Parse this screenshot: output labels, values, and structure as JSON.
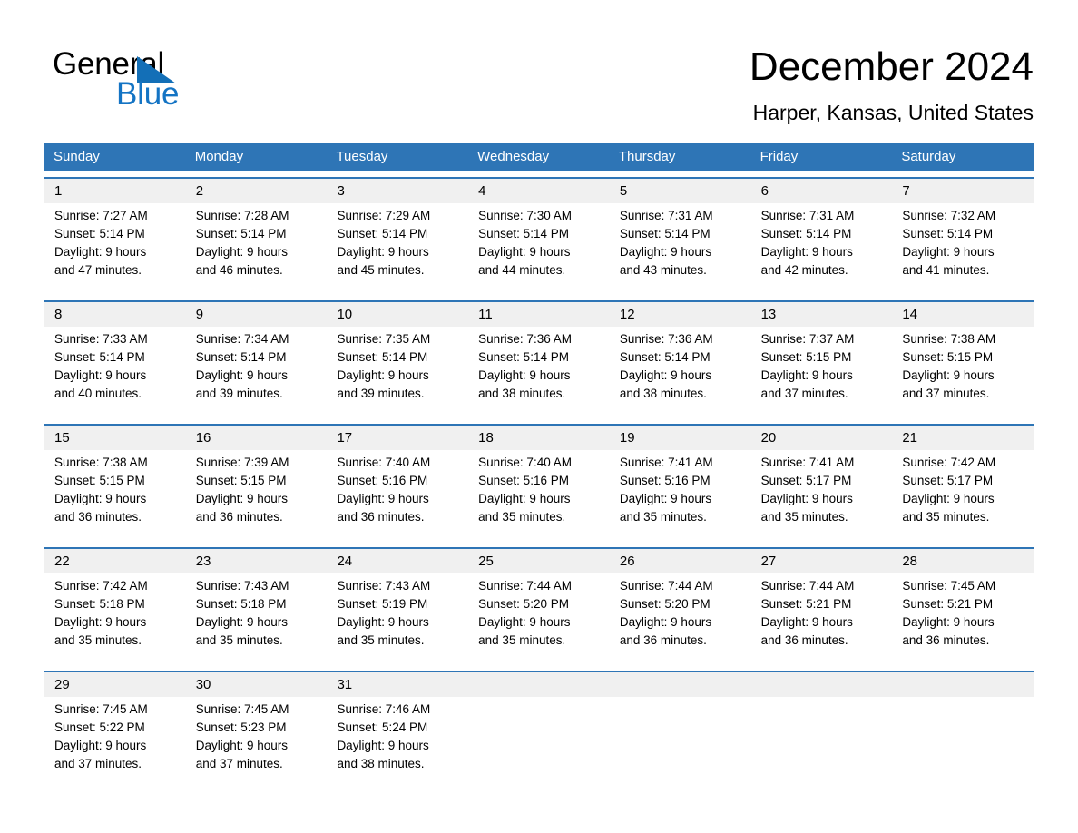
{
  "brand": {
    "name_part1": "General",
    "name_part2": "Blue",
    "triangle_color": "#136fb7",
    "blue_text_color": "#1474c4"
  },
  "header": {
    "month_title": "December 2024",
    "location": "Harper, Kansas, United States"
  },
  "theme": {
    "header_blue": "#2e75b6",
    "daynum_band": "#f0f0f0",
    "text": "#000000",
    "header_text": "#ffffff"
  },
  "weekdays": [
    "Sunday",
    "Monday",
    "Tuesday",
    "Wednesday",
    "Thursday",
    "Friday",
    "Saturday"
  ],
  "weeks": [
    {
      "days": [
        {
          "num": "1",
          "sunrise": "Sunrise: 7:27 AM",
          "sunset": "Sunset: 5:14 PM",
          "daylight1": "Daylight: 9 hours",
          "daylight2": "and 47 minutes."
        },
        {
          "num": "2",
          "sunrise": "Sunrise: 7:28 AM",
          "sunset": "Sunset: 5:14 PM",
          "daylight1": "Daylight: 9 hours",
          "daylight2": "and 46 minutes."
        },
        {
          "num": "3",
          "sunrise": "Sunrise: 7:29 AM",
          "sunset": "Sunset: 5:14 PM",
          "daylight1": "Daylight: 9 hours",
          "daylight2": "and 45 minutes."
        },
        {
          "num": "4",
          "sunrise": "Sunrise: 7:30 AM",
          "sunset": "Sunset: 5:14 PM",
          "daylight1": "Daylight: 9 hours",
          "daylight2": "and 44 minutes."
        },
        {
          "num": "5",
          "sunrise": "Sunrise: 7:31 AM",
          "sunset": "Sunset: 5:14 PM",
          "daylight1": "Daylight: 9 hours",
          "daylight2": "and 43 minutes."
        },
        {
          "num": "6",
          "sunrise": "Sunrise: 7:31 AM",
          "sunset": "Sunset: 5:14 PM",
          "daylight1": "Daylight: 9 hours",
          "daylight2": "and 42 minutes."
        },
        {
          "num": "7",
          "sunrise": "Sunrise: 7:32 AM",
          "sunset": "Sunset: 5:14 PM",
          "daylight1": "Daylight: 9 hours",
          "daylight2": "and 41 minutes."
        }
      ]
    },
    {
      "days": [
        {
          "num": "8",
          "sunrise": "Sunrise: 7:33 AM",
          "sunset": "Sunset: 5:14 PM",
          "daylight1": "Daylight: 9 hours",
          "daylight2": "and 40 minutes."
        },
        {
          "num": "9",
          "sunrise": "Sunrise: 7:34 AM",
          "sunset": "Sunset: 5:14 PM",
          "daylight1": "Daylight: 9 hours",
          "daylight2": "and 39 minutes."
        },
        {
          "num": "10",
          "sunrise": "Sunrise: 7:35 AM",
          "sunset": "Sunset: 5:14 PM",
          "daylight1": "Daylight: 9 hours",
          "daylight2": "and 39 minutes."
        },
        {
          "num": "11",
          "sunrise": "Sunrise: 7:36 AM",
          "sunset": "Sunset: 5:14 PM",
          "daylight1": "Daylight: 9 hours",
          "daylight2": "and 38 minutes."
        },
        {
          "num": "12",
          "sunrise": "Sunrise: 7:36 AM",
          "sunset": "Sunset: 5:14 PM",
          "daylight1": "Daylight: 9 hours",
          "daylight2": "and 38 minutes."
        },
        {
          "num": "13",
          "sunrise": "Sunrise: 7:37 AM",
          "sunset": "Sunset: 5:15 PM",
          "daylight1": "Daylight: 9 hours",
          "daylight2": "and 37 minutes."
        },
        {
          "num": "14",
          "sunrise": "Sunrise: 7:38 AM",
          "sunset": "Sunset: 5:15 PM",
          "daylight1": "Daylight: 9 hours",
          "daylight2": "and 37 minutes."
        }
      ]
    },
    {
      "days": [
        {
          "num": "15",
          "sunrise": "Sunrise: 7:38 AM",
          "sunset": "Sunset: 5:15 PM",
          "daylight1": "Daylight: 9 hours",
          "daylight2": "and 36 minutes."
        },
        {
          "num": "16",
          "sunrise": "Sunrise: 7:39 AM",
          "sunset": "Sunset: 5:15 PM",
          "daylight1": "Daylight: 9 hours",
          "daylight2": "and 36 minutes."
        },
        {
          "num": "17",
          "sunrise": "Sunrise: 7:40 AM",
          "sunset": "Sunset: 5:16 PM",
          "daylight1": "Daylight: 9 hours",
          "daylight2": "and 36 minutes."
        },
        {
          "num": "18",
          "sunrise": "Sunrise: 7:40 AM",
          "sunset": "Sunset: 5:16 PM",
          "daylight1": "Daylight: 9 hours",
          "daylight2": "and 35 minutes."
        },
        {
          "num": "19",
          "sunrise": "Sunrise: 7:41 AM",
          "sunset": "Sunset: 5:16 PM",
          "daylight1": "Daylight: 9 hours",
          "daylight2": "and 35 minutes."
        },
        {
          "num": "20",
          "sunrise": "Sunrise: 7:41 AM",
          "sunset": "Sunset: 5:17 PM",
          "daylight1": "Daylight: 9 hours",
          "daylight2": "and 35 minutes."
        },
        {
          "num": "21",
          "sunrise": "Sunrise: 7:42 AM",
          "sunset": "Sunset: 5:17 PM",
          "daylight1": "Daylight: 9 hours",
          "daylight2": "and 35 minutes."
        }
      ]
    },
    {
      "days": [
        {
          "num": "22",
          "sunrise": "Sunrise: 7:42 AM",
          "sunset": "Sunset: 5:18 PM",
          "daylight1": "Daylight: 9 hours",
          "daylight2": "and 35 minutes."
        },
        {
          "num": "23",
          "sunrise": "Sunrise: 7:43 AM",
          "sunset": "Sunset: 5:18 PM",
          "daylight1": "Daylight: 9 hours",
          "daylight2": "and 35 minutes."
        },
        {
          "num": "24",
          "sunrise": "Sunrise: 7:43 AM",
          "sunset": "Sunset: 5:19 PM",
          "daylight1": "Daylight: 9 hours",
          "daylight2": "and 35 minutes."
        },
        {
          "num": "25",
          "sunrise": "Sunrise: 7:44 AM",
          "sunset": "Sunset: 5:20 PM",
          "daylight1": "Daylight: 9 hours",
          "daylight2": "and 35 minutes."
        },
        {
          "num": "26",
          "sunrise": "Sunrise: 7:44 AM",
          "sunset": "Sunset: 5:20 PM",
          "daylight1": "Daylight: 9 hours",
          "daylight2": "and 36 minutes."
        },
        {
          "num": "27",
          "sunrise": "Sunrise: 7:44 AM",
          "sunset": "Sunset: 5:21 PM",
          "daylight1": "Daylight: 9 hours",
          "daylight2": "and 36 minutes."
        },
        {
          "num": "28",
          "sunrise": "Sunrise: 7:45 AM",
          "sunset": "Sunset: 5:21 PM",
          "daylight1": "Daylight: 9 hours",
          "daylight2": "and 36 minutes."
        }
      ]
    },
    {
      "days": [
        {
          "num": "29",
          "sunrise": "Sunrise: 7:45 AM",
          "sunset": "Sunset: 5:22 PM",
          "daylight1": "Daylight: 9 hours",
          "daylight2": "and 37 minutes."
        },
        {
          "num": "30",
          "sunrise": "Sunrise: 7:45 AM",
          "sunset": "Sunset: 5:23 PM",
          "daylight1": "Daylight: 9 hours",
          "daylight2": "and 37 minutes."
        },
        {
          "num": "31",
          "sunrise": "Sunrise: 7:46 AM",
          "sunset": "Sunset: 5:24 PM",
          "daylight1": "Daylight: 9 hours",
          "daylight2": "and 38 minutes."
        },
        {
          "num": "",
          "sunrise": "",
          "sunset": "",
          "daylight1": "",
          "daylight2": ""
        },
        {
          "num": "",
          "sunrise": "",
          "sunset": "",
          "daylight1": "",
          "daylight2": ""
        },
        {
          "num": "",
          "sunrise": "",
          "sunset": "",
          "daylight1": "",
          "daylight2": ""
        },
        {
          "num": "",
          "sunrise": "",
          "sunset": "",
          "daylight1": "",
          "daylight2": ""
        }
      ]
    }
  ]
}
